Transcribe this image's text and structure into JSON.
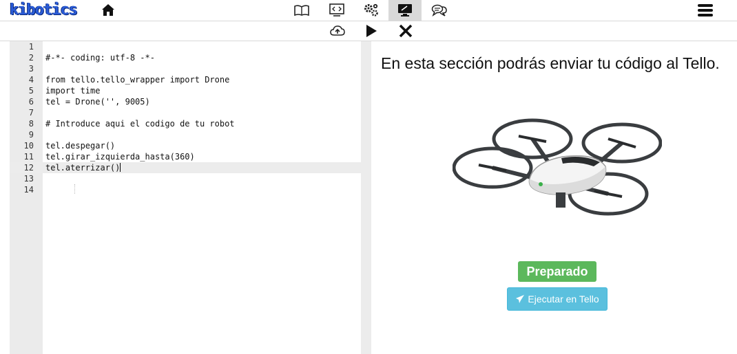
{
  "app": {
    "logo_text": "kibotics"
  },
  "topbar": {
    "nav": [
      {
        "icon": "book-icon",
        "name": "nav-book"
      },
      {
        "icon": "code-icon",
        "name": "nav-code"
      },
      {
        "icon": "gears-icon",
        "name": "nav-gears"
      },
      {
        "icon": "monitor-icon",
        "name": "nav-monitor",
        "active": true
      },
      {
        "icon": "chat-icon",
        "name": "nav-chat"
      }
    ],
    "menu_icon": "hamburger-menu-icon",
    "home_icon": "home-icon"
  },
  "toolbar": {
    "upload_icon": "cloud-upload-icon",
    "play_icon": "play-icon",
    "close_icon": "close-icon"
  },
  "editor": {
    "active_line": 12,
    "lines": [
      {
        "n": "1",
        "text": ""
      },
      {
        "n": "2",
        "text": "#-*- coding: utf-8 -*-"
      },
      {
        "n": "3",
        "text": ""
      },
      {
        "n": "4",
        "text": "from tello.tello_wrapper import Drone"
      },
      {
        "n": "5",
        "text": "import time"
      },
      {
        "n": "6",
        "text": "tel = Drone('', 9005)"
      },
      {
        "n": "7",
        "text": ""
      },
      {
        "n": "8",
        "text": "# Introduce aqui el codigo de tu robot"
      },
      {
        "n": "9",
        "text": ""
      },
      {
        "n": "10",
        "text": "tel.despegar()"
      },
      {
        "n": "11",
        "text": "tel.girar_izquierda_hasta(360)"
      },
      {
        "n": "12",
        "text": "tel.aterrizar()"
      },
      {
        "n": "13",
        "text": ""
      },
      {
        "n": "14",
        "text": ""
      }
    ]
  },
  "panel": {
    "heading": "En esta sección podrás enviar tu código al Tello.",
    "status_label": "Preparado",
    "status_color": "#5cb85c",
    "run_label": "Ejecutar en Tello",
    "run_icon": "paper-plane-icon",
    "run_color": "#5bc0de"
  }
}
